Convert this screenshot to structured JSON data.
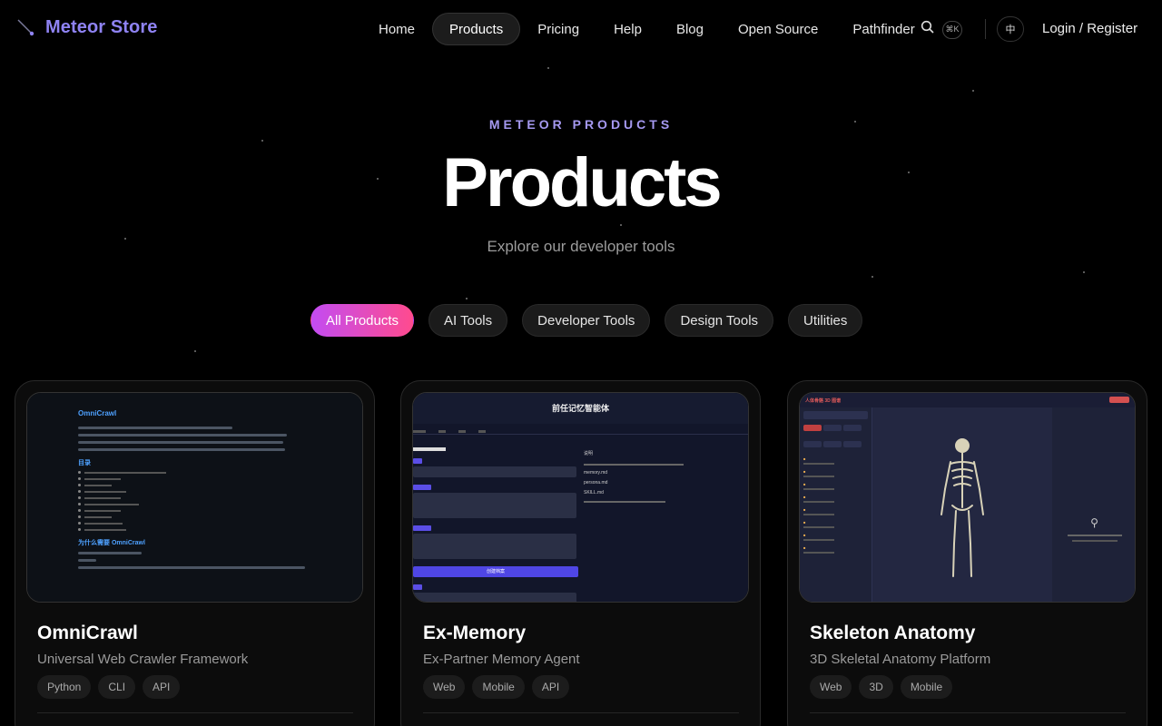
{
  "nav": {
    "brand": "Meteor Store",
    "items": [
      {
        "label": "Home",
        "active": false
      },
      {
        "label": "Products",
        "active": true
      },
      {
        "label": "Pricing",
        "active": false
      },
      {
        "label": "Help",
        "active": false
      },
      {
        "label": "Blog",
        "active": false
      },
      {
        "label": "Open Source",
        "active": false
      },
      {
        "label": "Pathfinder",
        "active": false
      }
    ],
    "search_shortcut": "⌘K",
    "language": "中",
    "login": "Login / Register"
  },
  "hero": {
    "eyebrow": "METEOR PRODUCTS",
    "title": "Products",
    "subtitle": "Explore our developer tools"
  },
  "filters": [
    {
      "label": "All Products",
      "active": true
    },
    {
      "label": "AI Tools",
      "active": false
    },
    {
      "label": "Developer Tools",
      "active": false
    },
    {
      "label": "Design Tools",
      "active": false
    },
    {
      "label": "Utilities",
      "active": false
    }
  ],
  "products": [
    {
      "name": "OmniCrawl",
      "description": "Universal Web Crawler Framework",
      "tags": [
        "Python",
        "CLI",
        "API"
      ],
      "preview": {
        "title": "OmniCrawl",
        "section": "目录",
        "section2": "为什么需要 OmniCrawl"
      }
    },
    {
      "name": "Ex-Memory",
      "description": "Ex-Partner Memory Agent",
      "tags": [
        "Web",
        "Mobile",
        "API"
      ],
      "preview": {
        "title": "前任记忆智能体",
        "button": "创建档案",
        "notes_title": "说明",
        "notes": [
          "memory.md",
          "persona.md",
          "SKILL.md"
        ]
      }
    },
    {
      "name": "Skeleton Anatomy",
      "description": "3D Skeletal Anatomy Platform",
      "tags": [
        "Web",
        "3D",
        "Mobile"
      ],
      "preview": {
        "title": "人体骨骼 3D 图谱"
      }
    }
  ],
  "colors": {
    "brand": "#8f83f3",
    "accent_start": "#c34cf2",
    "accent_end": "#ff4b8e",
    "background": "#000000"
  }
}
